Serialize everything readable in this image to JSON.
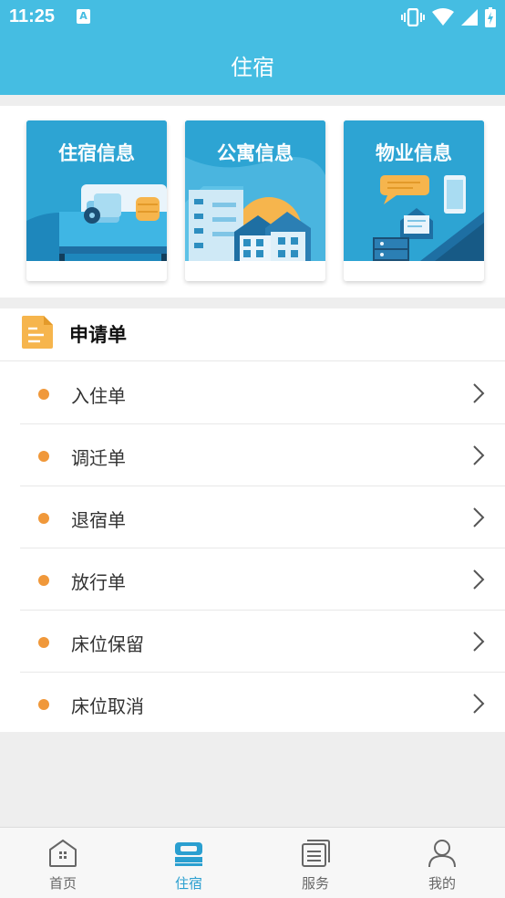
{
  "status_bar": {
    "time": "11:25",
    "notification": "A"
  },
  "header": {
    "title": "住宿"
  },
  "cards": [
    {
      "label": "住宿信息",
      "icon": "bed-illustration"
    },
    {
      "label": "公寓信息",
      "icon": "apartment-illustration"
    },
    {
      "label": "物业信息",
      "icon": "property-illustration"
    }
  ],
  "applications": {
    "title": "申请单",
    "items": [
      {
        "label": "入住单"
      },
      {
        "label": "调迁单"
      },
      {
        "label": "退宿单"
      },
      {
        "label": "放行单"
      },
      {
        "label": "床位保留"
      },
      {
        "label": "床位取消"
      }
    ]
  },
  "tabs": [
    {
      "label": "首页",
      "icon": "home-icon",
      "active": false
    },
    {
      "label": "住宿",
      "icon": "bed-icon",
      "active": true
    },
    {
      "label": "服务",
      "icon": "services-icon",
      "active": false
    },
    {
      "label": "我的",
      "icon": "profile-icon",
      "active": false
    }
  ],
  "colors": {
    "primary": "#45bde2",
    "accent_dot": "#f0983a",
    "active_tab": "#2a9fd0"
  }
}
